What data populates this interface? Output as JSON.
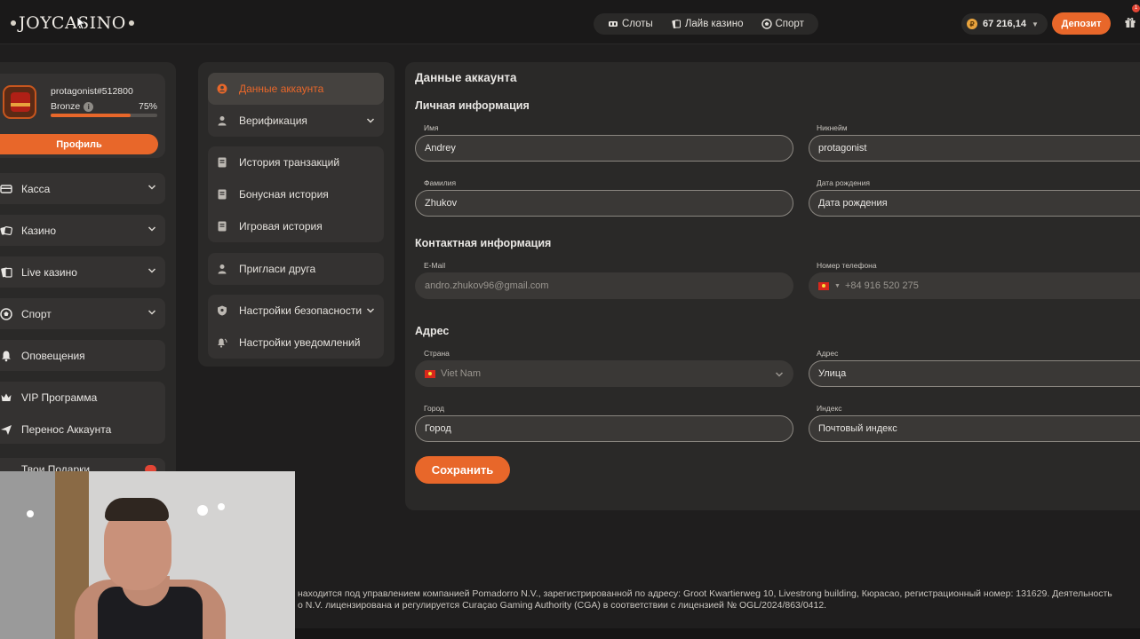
{
  "topbar": {
    "logo": "JOYCASINO",
    "nav": [
      {
        "label": "Слоты",
        "icon": "slots-icon"
      },
      {
        "label": "Лайв казино",
        "icon": "live-casino-icon"
      },
      {
        "label": "Спорт",
        "icon": "sport-ball-icon"
      }
    ],
    "balance": "67 216,14",
    "deposit_label": "Депозит",
    "gift_badge": "1"
  },
  "profile": {
    "username": "protagonist#512800",
    "rank": "Bronze",
    "progress_pct": "75%",
    "progress_value": 0.75,
    "profile_button": "Профиль"
  },
  "sidebar": {
    "items": [
      {
        "label": "Касса",
        "icon": "cashier-icon",
        "has_chevron": true
      },
      {
        "label": "Казино",
        "icon": "casino-icon",
        "has_chevron": true
      },
      {
        "label": "Live казино",
        "icon": "live-icon",
        "has_chevron": true
      },
      {
        "label": "Спорт",
        "icon": "sport-icon",
        "has_chevron": true
      },
      {
        "label": "Оповещения",
        "icon": "bell-icon",
        "has_chevron": false
      },
      {
        "label": "VIP Программа",
        "icon": "crown-icon",
        "has_chevron": false
      },
      {
        "label": "Перенос Аккаунта",
        "icon": "plane-icon",
        "has_chevron": false
      },
      {
        "label": "Твои Подарки",
        "icon": "gift-icon",
        "has_chevron": false
      }
    ]
  },
  "account_menu": {
    "items": [
      {
        "label": "Данные аккаунта",
        "icon": "user-circle-icon"
      },
      {
        "label": "Верификация",
        "icon": "person-icon"
      },
      {
        "label": "История транзакций",
        "icon": "document-icon"
      },
      {
        "label": "Бонусная история",
        "icon": "document-icon"
      },
      {
        "label": "Игровая история",
        "icon": "document-icon"
      },
      {
        "label": "Пригласи друга",
        "icon": "person-icon"
      },
      {
        "label": "Настройки безопасности",
        "icon": "shield-icon"
      },
      {
        "label": "Настройки уведомлений",
        "icon": "bell-wave-icon"
      }
    ]
  },
  "form": {
    "title": "Данные аккаунта",
    "personal_heading": "Личная информация",
    "contact_heading": "Контактная информация",
    "address_heading": "Адрес",
    "first_name_label": "Имя",
    "first_name": "Andrey",
    "nickname_label": "Никнейм",
    "nickname": "protagonist",
    "last_name_label": "Фамилия",
    "last_name": "Zhukov",
    "birthdate_label": "Дата рождения",
    "birthdate_placeholder": "Дата рождения",
    "email_label": "E-Mail",
    "email": "andro.zhukov96@gmail.com",
    "phone_label": "Номер телефона",
    "phone": "+84 916 520 275",
    "country_label": "Страна",
    "country": "Viet Nam",
    "address_label": "Адрес",
    "address_placeholder": "Улица",
    "city_label": "Город",
    "city_placeholder": "Город",
    "zip_label": "Индекс",
    "zip_placeholder": "Почтовый индекс",
    "save_label": "Сохранить"
  },
  "footer": {
    "line1": "находится под управлением компанией Pomadorro N.V., зарегистрированной по адресу: Groot Kwartierweg 10, Livestrong building, Кюрасао, регистрационный номер: 131629. Деятельность",
    "line2": "o N.V. лицензирована и регулируется Curaçao Gaming Authority (CGA) в соответствии с лицензией № OGL/2024/863/0412."
  },
  "colors": {
    "accent": "#e8672a",
    "background": "#1f1e1e",
    "panel": "#2a2928",
    "card": "#343231"
  }
}
